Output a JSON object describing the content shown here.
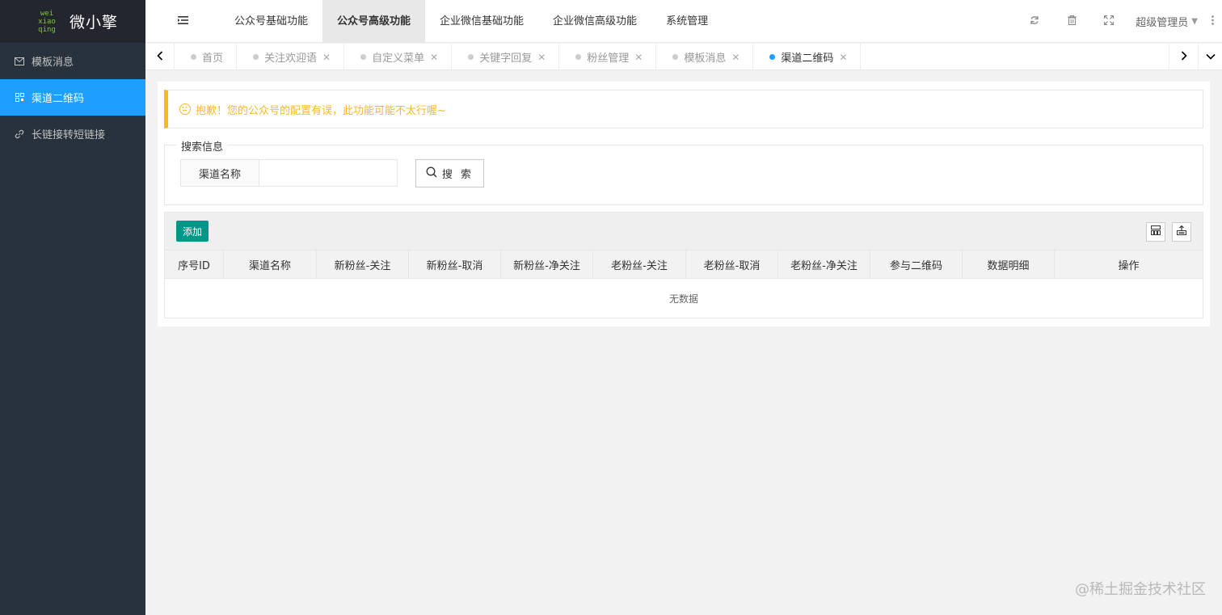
{
  "brand": {
    "mark_lines": [
      "wei",
      "xiao",
      "qing"
    ],
    "name": "微小擎",
    "accent": "#7fc04a"
  },
  "sidebar": {
    "items": [
      {
        "label": "模板消息",
        "icon": "mail-icon",
        "active": false
      },
      {
        "label": "渠道二维码",
        "icon": "qrcode-icon",
        "active": true
      },
      {
        "label": "长链接转短链接",
        "icon": "link-icon",
        "active": false
      }
    ]
  },
  "header": {
    "nav": [
      {
        "label": "公众号基础功能",
        "active": false
      },
      {
        "label": "公众号高级功能",
        "active": true
      },
      {
        "label": "企业微信基础功能",
        "active": false
      },
      {
        "label": "企业微信高级功能",
        "active": false
      },
      {
        "label": "系统管理",
        "active": false
      }
    ],
    "user": "超级管理员"
  },
  "tabs": [
    {
      "label": "首页",
      "closable": false,
      "active": false
    },
    {
      "label": "关注欢迎语",
      "closable": true,
      "active": false
    },
    {
      "label": "自定义菜单",
      "closable": true,
      "active": false
    },
    {
      "label": "关键字回复",
      "closable": true,
      "active": false
    },
    {
      "label": "粉丝管理",
      "closable": true,
      "active": false
    },
    {
      "label": "模板消息",
      "closable": true,
      "active": false
    },
    {
      "label": "渠道二维码",
      "closable": true,
      "active": true
    }
  ],
  "alert": {
    "text": "抱歉！您的公众号的配置有误，此功能可能不太行喔~",
    "color": "#f7b824"
  },
  "search": {
    "legend": "搜索信息",
    "field_label": "渠道名称",
    "field_value": "",
    "button": "搜 索"
  },
  "table": {
    "add_button": "添加",
    "columns": [
      "序号ID",
      "渠道名称",
      "新粉丝-关注",
      "新粉丝-取消",
      "新粉丝-净关注",
      "老粉丝-关注",
      "老粉丝-取消",
      "老粉丝-净关注",
      "参与二维码",
      "数据明细",
      "操作"
    ],
    "empty_text": "无数据"
  },
  "watermark": "@稀土掘金技术社区",
  "colors": {
    "sidebar_bg": "#28323d",
    "active_blue": "#1e9fff",
    "add_green": "#009688"
  }
}
